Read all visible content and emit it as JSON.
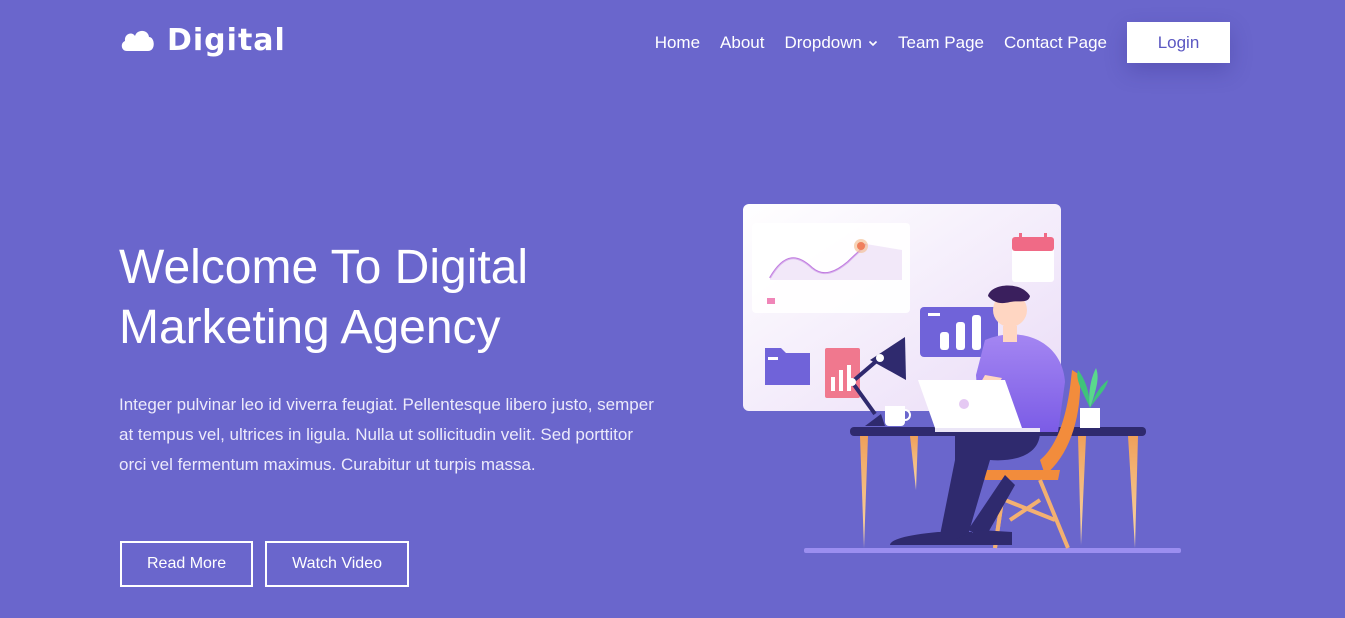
{
  "brand": {
    "name": "Digital",
    "icon": "cloud-icon"
  },
  "nav": {
    "items": [
      {
        "label": "Home"
      },
      {
        "label": "About"
      },
      {
        "label": "Dropdown",
        "icon": "chevron-down-icon"
      },
      {
        "label": "Team Page"
      },
      {
        "label": "Contact Page"
      }
    ],
    "login_label": "Login"
  },
  "hero": {
    "title_line1": "Welcome To Digital",
    "title_line2": "Marketing Agency",
    "description": "Integer pulvinar leo id viverra feugiat. Pellentesque libero justo, semper at tempus vel, ultrices in ligula. Nulla ut sollicitudin velit. Sed porttitor orci vel fermentum maximus. Curabitur ut turpis massa.",
    "buttons": {
      "read_more": "Read More",
      "watch_video": "Watch Video"
    }
  },
  "colors": {
    "background": "#6a66cc",
    "accent": "#5b57c2",
    "white": "#ffffff"
  }
}
